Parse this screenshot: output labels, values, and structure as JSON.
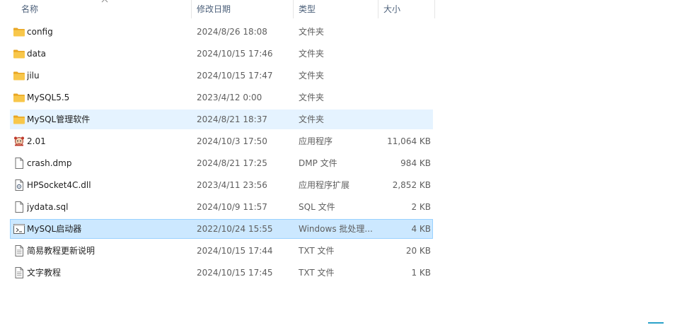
{
  "columns": {
    "name": "名称",
    "date": "修改日期",
    "type": "类型",
    "size": "大小"
  },
  "sort": {
    "column": "name",
    "direction": "ascending",
    "icon": "sort-ascending-icon"
  },
  "files": [
    {
      "name": "config",
      "date": "2024/8/26 18:08",
      "type": "文件夹",
      "size": "",
      "icon": "folder-icon",
      "state": ""
    },
    {
      "name": "data",
      "date": "2024/10/15 17:46",
      "type": "文件夹",
      "size": "",
      "icon": "folder-icon",
      "state": ""
    },
    {
      "name": "jilu",
      "date": "2024/10/15 17:47",
      "type": "文件夹",
      "size": "",
      "icon": "folder-icon",
      "state": ""
    },
    {
      "name": "MySQL5.5",
      "date": "2023/4/12 0:00",
      "type": "文件夹",
      "size": "",
      "icon": "folder-icon",
      "state": ""
    },
    {
      "name": "MySQL管理软件",
      "date": "2024/8/21 18:37",
      "type": "文件夹",
      "size": "",
      "icon": "folder-icon",
      "state": "hover"
    },
    {
      "name": "2.01",
      "date": "2024/10/3 17:50",
      "type": "应用程序",
      "size": "11,064 KB",
      "icon": "application-icon",
      "state": ""
    },
    {
      "name": "crash.dmp",
      "date": "2024/8/21 17:25",
      "type": "DMP 文件",
      "size": "984 KB",
      "icon": "file-icon",
      "state": ""
    },
    {
      "name": "HPSocket4C.dll",
      "date": "2023/4/11 23:56",
      "type": "应用程序扩展",
      "size": "2,852 KB",
      "icon": "dll-file-icon",
      "state": ""
    },
    {
      "name": "jydata.sql",
      "date": "2024/10/9 11:57",
      "type": "SQL 文件",
      "size": "2 KB",
      "icon": "file-icon",
      "state": ""
    },
    {
      "name": "MySQL启动器",
      "date": "2022/10/24 15:55",
      "type": "Windows 批处理...",
      "size": "4 KB",
      "icon": "batch-file-icon",
      "state": "selected"
    },
    {
      "name": "简易教程更新说明",
      "date": "2024/10/15 17:44",
      "type": "TXT 文件",
      "size": "20 KB",
      "icon": "text-file-icon",
      "state": ""
    },
    {
      "name": "文字教程",
      "date": "2024/10/15 17:45",
      "type": "TXT 文件",
      "size": "1 KB",
      "icon": "text-file-icon",
      "state": ""
    }
  ],
  "colors": {
    "hover": "#e5f3ff",
    "selected": "#cce8ff",
    "selected_border": "#99d1ff",
    "folder": "#f8c74b"
  }
}
